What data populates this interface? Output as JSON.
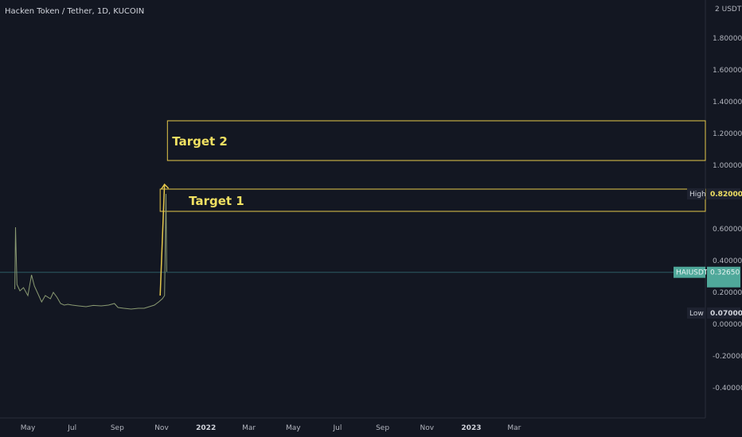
{
  "header": {
    "title": "Hacken Token / Tether, 1D, KUCOIN",
    "currency": "USDT",
    "currency_prefix": "2"
  },
  "colors": {
    "background": "#131722",
    "axis_text": "#b2b5be",
    "candle": "#8a9a72",
    "zone": "#e6c84a",
    "arrow": "#e6c84a",
    "price_tag": "#4fa89a",
    "price_line": "#2c5b62"
  },
  "chart_data": {
    "type": "line",
    "ylim": [
      -0.5,
      2.0
    ],
    "yticks": [
      "1.80000",
      "1.60000",
      "1.40000",
      "1.20000",
      "1.00000",
      "0.60000",
      "0.40000",
      "0.20000",
      "0.00000",
      "-0.20000",
      "-0.40000"
    ],
    "ytick_values": [
      1.8,
      1.6,
      1.4,
      1.2,
      1.0,
      0.6,
      0.4,
      0.2,
      0.0,
      -0.2,
      -0.4
    ],
    "xticks": [
      {
        "label": "May",
        "date": "2021-05-01",
        "bold": false
      },
      {
        "label": "Jul",
        "date": "2021-07-01",
        "bold": false
      },
      {
        "label": "Sep",
        "date": "2021-09-01",
        "bold": false
      },
      {
        "label": "Nov",
        "date": "2021-11-01",
        "bold": false
      },
      {
        "label": "2022",
        "date": "2022-01-01",
        "bold": true
      },
      {
        "label": "Mar",
        "date": "2022-03-01",
        "bold": false
      },
      {
        "label": "May",
        "date": "2022-05-01",
        "bold": false
      },
      {
        "label": "Jul",
        "date": "2022-07-01",
        "bold": false
      },
      {
        "label": "Sep",
        "date": "2022-09-01",
        "bold": false
      },
      {
        "label": "Nov",
        "date": "2022-11-01",
        "bold": false
      },
      {
        "label": "2023",
        "date": "2023-01-01",
        "bold": true
      },
      {
        "label": "Mar",
        "date": "2023-03-01",
        "bold": false
      }
    ],
    "series": [
      {
        "points": [
          [
            "2021-04-13",
            0.22
          ],
          [
            "2021-04-14",
            0.61
          ],
          [
            "2021-04-16",
            0.25
          ],
          [
            "2021-04-20",
            0.21
          ],
          [
            "2021-04-25",
            0.23
          ],
          [
            "2021-05-01",
            0.18
          ],
          [
            "2021-05-06",
            0.31
          ],
          [
            "2021-05-10",
            0.24
          ],
          [
            "2021-05-15",
            0.19
          ],
          [
            "2021-05-20",
            0.14
          ],
          [
            "2021-05-25",
            0.18
          ],
          [
            "2021-06-01",
            0.16
          ],
          [
            "2021-06-05",
            0.2
          ],
          [
            "2021-06-10",
            0.17
          ],
          [
            "2021-06-15",
            0.13
          ],
          [
            "2021-06-20",
            0.12
          ],
          [
            "2021-06-25",
            0.125
          ],
          [
            "2021-07-01",
            0.12
          ],
          [
            "2021-07-10",
            0.115
          ],
          [
            "2021-07-20",
            0.11
          ],
          [
            "2021-07-30",
            0.118
          ],
          [
            "2021-08-10",
            0.115
          ],
          [
            "2021-08-20",
            0.12
          ],
          [
            "2021-08-28",
            0.13
          ],
          [
            "2021-09-02",
            0.105
          ],
          [
            "2021-09-10",
            0.1
          ],
          [
            "2021-09-20",
            0.095
          ],
          [
            "2021-09-30",
            0.1
          ],
          [
            "2021-10-08",
            0.1
          ],
          [
            "2021-10-15",
            0.11
          ],
          [
            "2021-10-22",
            0.12
          ],
          [
            "2021-10-28",
            0.14
          ],
          [
            "2021-11-02",
            0.16
          ],
          [
            "2021-11-05",
            0.18
          ],
          [
            "2021-11-07",
            0.82
          ],
          [
            "2021-11-08",
            0.33
          ]
        ]
      }
    ],
    "zones": [
      {
        "label": "Target 2",
        "from": 1.03,
        "to": 1.28,
        "start": "2021-11-09"
      },
      {
        "label": "Target 1",
        "from": 0.71,
        "to": 0.85,
        "start": "2021-10-30"
      }
    ],
    "arrow": {
      "from": [
        "2021-10-30",
        0.18
      ],
      "to": [
        "2021-11-05",
        0.88
      ]
    },
    "tags": {
      "high": {
        "label": "High",
        "value": "0.82000",
        "y": 0.82
      },
      "last": {
        "label": "HAIUSDT",
        "value": "0.32650",
        "y": 0.3265
      },
      "low": {
        "label": "Low",
        "value": "0.07000",
        "y": 0.07
      }
    }
  }
}
